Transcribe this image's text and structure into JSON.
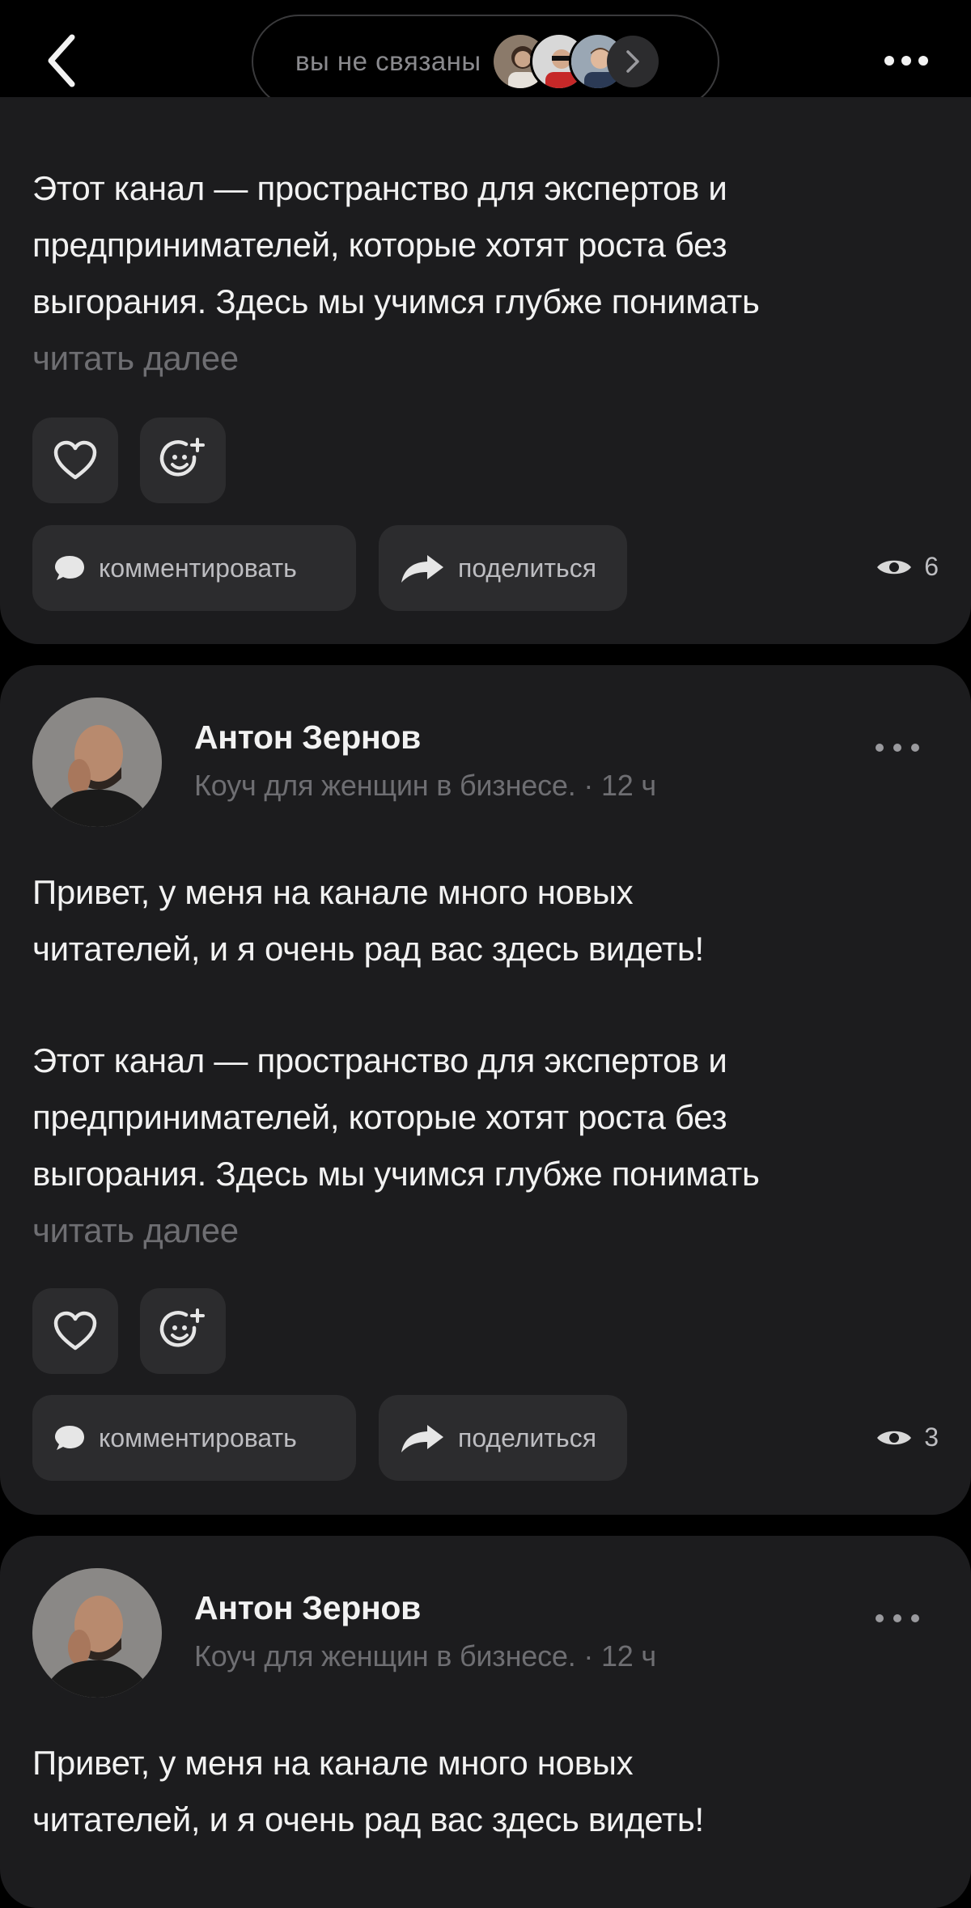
{
  "header": {
    "connection_text": "вы не связаны"
  },
  "posts": [
    {
      "body_tail": "Этот канал — пространство для экспертов и\nпредпринимателей, которые хотят роста без\nвыгорания. Здесь мы учимся глубже понимать",
      "read_more": "читать далее",
      "comment_label": "комментировать",
      "share_label": "поделиться",
      "views": "6"
    },
    {
      "author_name": "Антон Зернов",
      "author_description": "Коуч для женщин в бизнесе.",
      "time": "· 12 ч",
      "greeting": "Привет, у меня на канале много новых\nчитателей, и я очень рад вас здесь видеть!",
      "body": "Этот канал — пространство для экспертов и\nпредпринимателей, которые хотят роста без\nвыгорания. Здесь мы учимся глубже понимать",
      "read_more": "читать далее",
      "comment_label": "комментировать",
      "share_label": "поделиться",
      "views": "3"
    },
    {
      "author_name": "Антон Зернов",
      "author_description": "Коуч для женщин в бизнесе.",
      "time": "· 12 ч",
      "greeting": "Привет, у меня на канале много новых\nчитателей, и я очень рад вас здесь видеть!"
    }
  ],
  "colors": {
    "background": "#000000",
    "card": "#1c1c1e",
    "button": "#2c2c2e",
    "muted_text": "#6e6e72"
  }
}
